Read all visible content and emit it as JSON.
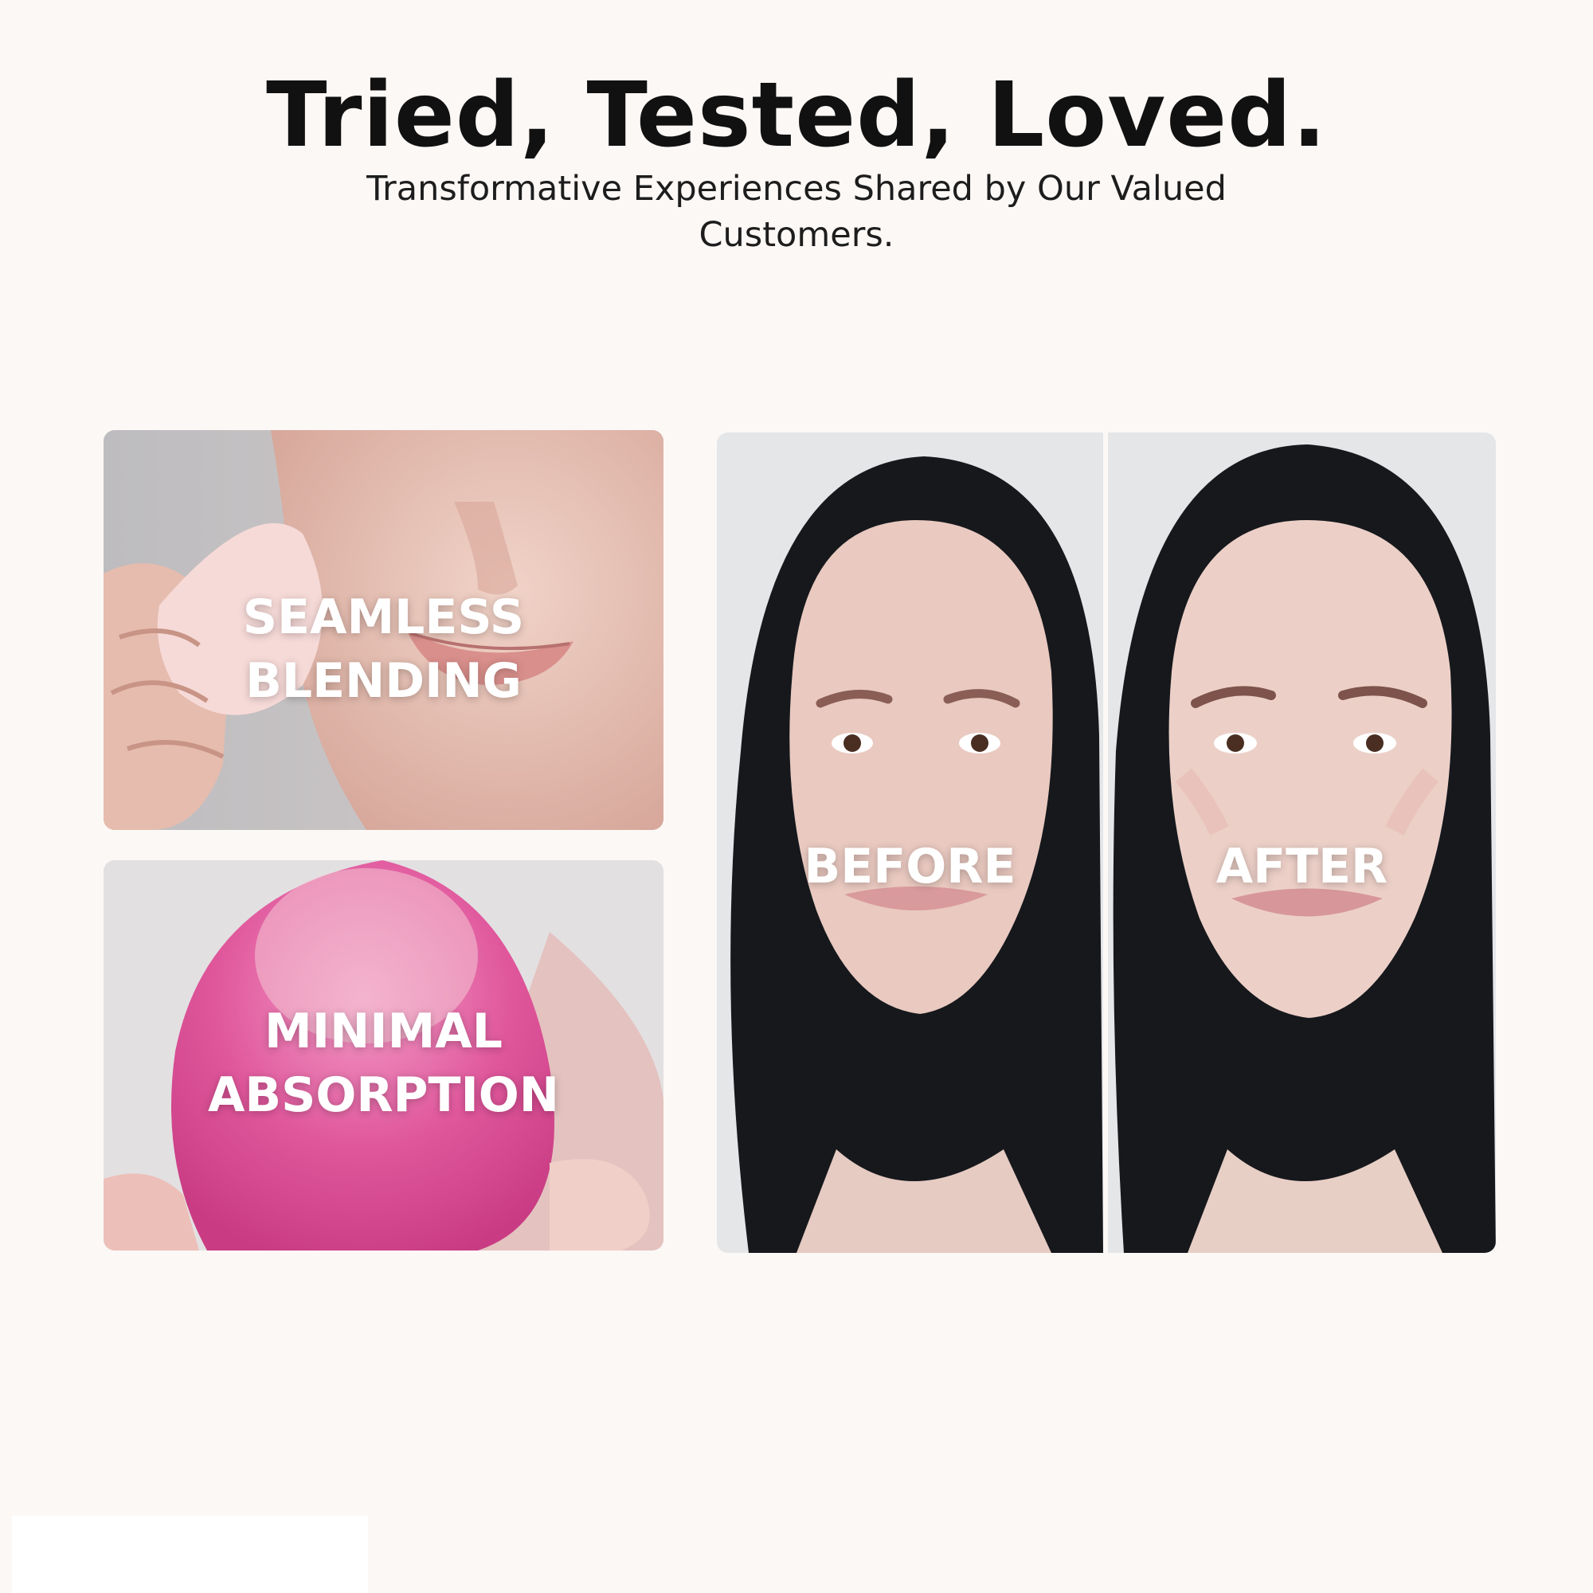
{
  "header": {
    "title": "Tried, Tested, Loved.",
    "subtitle": "Transformative Experiences Shared by Our Valued Customers."
  },
  "panels": {
    "blending": {
      "line1": "SEAMLESS",
      "line2": "BLENDING"
    },
    "absorption": {
      "line1": "MINIMAL",
      "line2": "ABSORPTION"
    },
    "before": {
      "label": "BEFORE"
    },
    "after": {
      "label": "AFTER"
    }
  },
  "colors": {
    "background": "#fcf8f6",
    "heading": "#111111",
    "sponge_pink": "#e0579c",
    "light_sponge": "#f6d8d8",
    "hair": "#16181c",
    "skin": "#e9c9c0"
  }
}
